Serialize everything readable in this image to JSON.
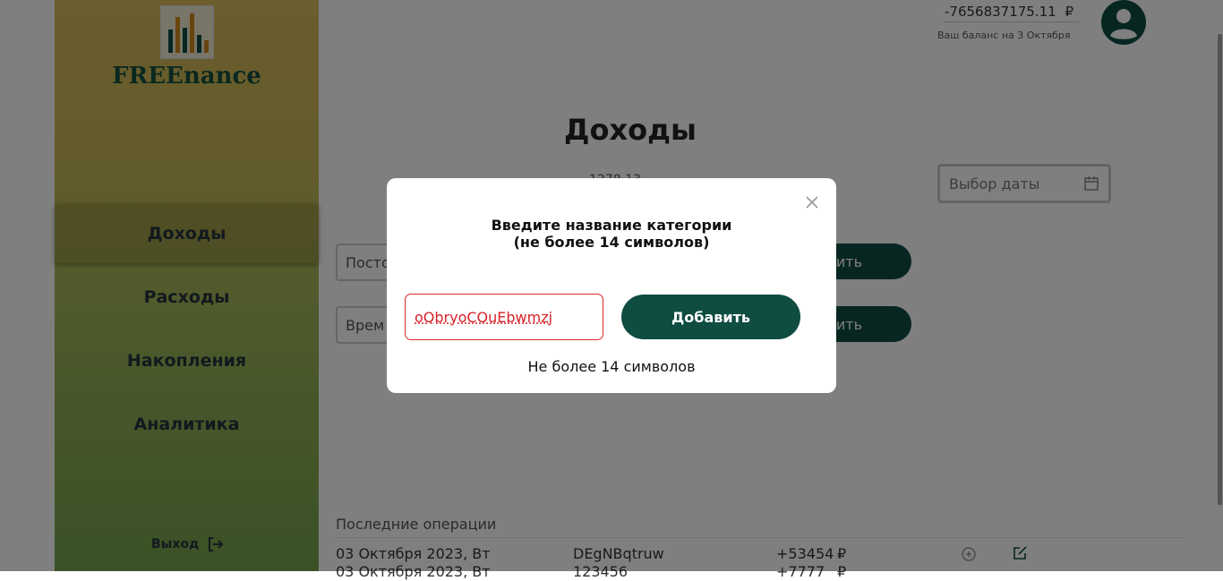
{
  "app": {
    "name": "FREEnance"
  },
  "sidebar": {
    "items": [
      {
        "label": "Доходы",
        "active": true
      },
      {
        "label": "Расходы",
        "active": false
      },
      {
        "label": "Накопления",
        "active": false
      },
      {
        "label": "Аналитика",
        "active": false
      }
    ],
    "logout_label": "Выход"
  },
  "header": {
    "balance_value": "-7656837175.11",
    "currency": "₽",
    "balance_caption": "Ваш баланс на  3  Октября"
  },
  "main": {
    "title": "Доходы",
    "amount_partial": "1278.13",
    "date_picker_placeholder": "Выбор даты",
    "permanent_field": "Посто",
    "temporary_field": "Врем",
    "add_button_partial": "ить",
    "add_button_partial_2": "ить",
    "recent_title": "Последние операции",
    "operations": [
      {
        "date": "03 Октября 2023, Вт",
        "category": "DEgNBqtruw",
        "amount": "+53454",
        "currency": "₽"
      },
      {
        "date": "03 Октября 2023, Вт",
        "category": "123456",
        "amount": "+7777",
        "currency": "₽"
      }
    ]
  },
  "modal": {
    "title_line1": "Введите название категории",
    "title_line2": "(не более 14 символов)",
    "input_value": "oQbryoCOuEbwmzj",
    "add_label": "Добавить",
    "hint": "Не более 14 символов"
  },
  "colors": {
    "accent": "#0f4c42",
    "error": "#e0262b",
    "sidebar_top": "#d7ba5b",
    "sidebar_bottom": "#74a34d"
  }
}
